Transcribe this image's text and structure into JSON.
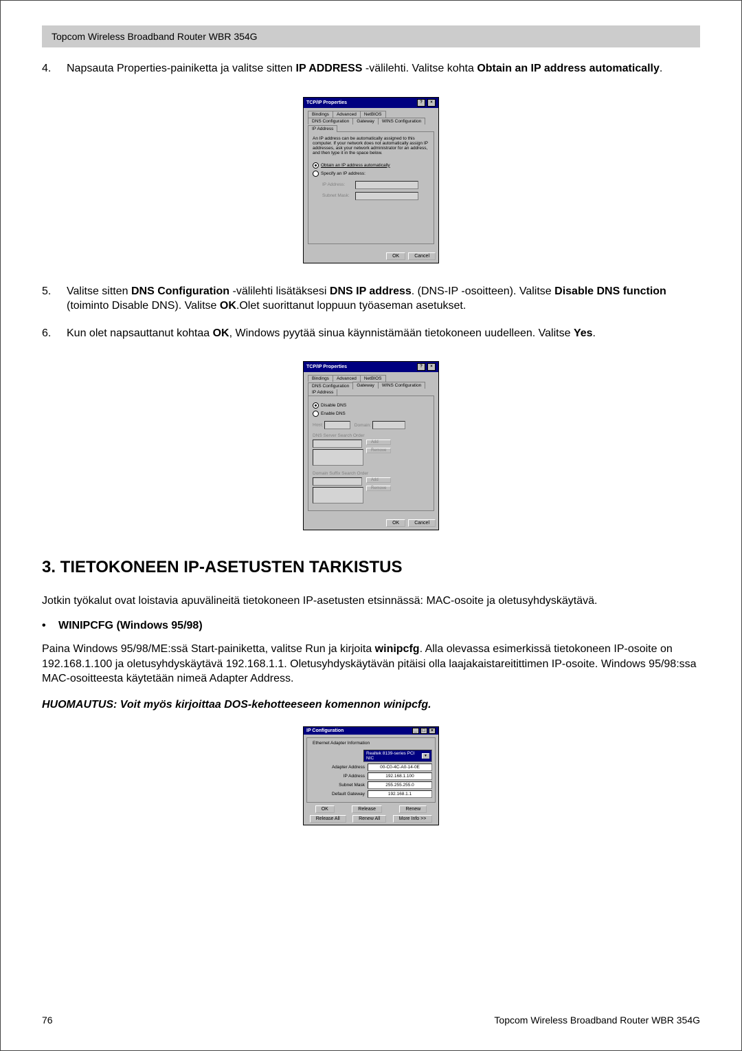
{
  "header_bar": "Topcom Wireless Broadband Router WBR 354G",
  "list": {
    "item4_num": "4.",
    "item4_a": "Napsauta Properties-painiketta ja valitse sitten ",
    "item4_b": "IP ADDRESS",
    "item4_c": " -välilehti. Valitse kohta ",
    "item4_d": "Obtain an IP address automatically",
    "item4_e": ".",
    "item5_num": "5.",
    "item5_a": "Valitse sitten ",
    "item5_b": "DNS Configuration",
    "item5_c": " -välilehti lisätäksesi ",
    "item5_d": "DNS IP address",
    "item5_e": ". (DNS-IP -osoitteen). Valitse ",
    "item5_f": "Disable DNS function",
    "item5_g": " (toiminto Disable DNS). Valitse ",
    "item5_h": "OK",
    "item5_i": ".Olet suorittanut loppuun työaseman asetukset.",
    "item6_num": "6.",
    "item6_a": "Kun olet napsauttanut kohtaa ",
    "item6_b": "OK",
    "item6_c": ", Windows pyytää sinua käynnistämään tietokoneen uudelleen. Valitse ",
    "item6_d": "Yes",
    "item6_e": "."
  },
  "dlg1": {
    "title": "TCP/IP Properties",
    "help": "?",
    "close": "×",
    "tab_bindings": "Bindings",
    "tab_advanced": "Advanced",
    "tab_netbios": "NetBIOS",
    "tab_dns": "DNS Configuration",
    "tab_gateway": "Gateway",
    "tab_wins": "WINS Configuration",
    "tab_ip": "IP Address",
    "desc": "An IP address can be automatically assigned to this computer. If your network does not automatically assign IP addresses, ask your network administrator for an address, and then type it in the space below.",
    "radio_auto": "Obtain an IP address automatically",
    "radio_spec": "Specify an IP address:",
    "lbl_ip": "IP Address:",
    "lbl_mask": "Subnet Mask:",
    "ok": "OK",
    "cancel": "Cancel"
  },
  "dlg2": {
    "title": "TCP/IP Properties",
    "help": "?",
    "close": "×",
    "tab_bindings": "Bindings",
    "tab_advanced": "Advanced",
    "tab_netbios": "NetBIOS",
    "tab_dns": "DNS Configuration",
    "tab_gateway": "Gateway",
    "tab_wins": "WINS Configuration",
    "tab_ip": "IP Address",
    "radio_disable": "Disable DNS",
    "radio_enable": "Enable DNS",
    "lbl_host": "Host:",
    "lbl_domain": "Domain:",
    "lbl_dns_order": "DNS Server Search Order",
    "lbl_suffix": "Domain Suffix Search Order",
    "add": "Add",
    "remove": "Remove",
    "ok": "OK",
    "cancel": "Cancel"
  },
  "section_title": "3. TIETOKONEEN IP-ASETUSTEN TARKISTUS",
  "para1": "Jotkin työkalut ovat loistavia apuvälineitä tietokoneen IP-asetusten etsinnässä: MAC-osoite ja oletusyhdyskäytävä.",
  "bullet1": "WINIPCFG (Windows 95/98)",
  "para2_a": "Paina Windows 95/98/ME:ssä Start-painiketta, valitse Run ja kirjoita ",
  "para2_b": "winipcfg",
  "para2_c": ". Alla olevassa esimerkissä tietokoneen IP-osoite on 192.168.1.100 ja oletusyhdyskäytävä 192.168.1.1. Oletusyhdyskäytävän pitäisi olla laajakaistareitittimen IP-osoite. Windows 95/98:ssa MAC-osoitteesta käytetään nimeä Adapter Address.",
  "note": "HUOMAUTUS: Voit myös kirjoittaa DOS-kehotteeseen komennon winipcfg.",
  "ipcfg": {
    "title": "IP Configuration",
    "min": "_",
    "max": "□",
    "close": "×",
    "group": "Ethernet Adapter Information",
    "adapter": "Realtek 8139-series PCI NIC",
    "lbl_adapter": "Adapter Address",
    "val_adapter": "00-C0-4C-A0-14-0E",
    "lbl_ip": "IP Address",
    "val_ip": "192.168.1.100",
    "lbl_mask": "Subnet Mask",
    "val_mask": "255.255.255.0",
    "lbl_gw": "Default Gateway",
    "val_gw": "192.168.1.1",
    "ok": "OK",
    "release": "Release",
    "renew": "Renew",
    "release_all": "Release All",
    "renew_all": "Renew All",
    "more": "More Info >>"
  },
  "footer": {
    "page": "76",
    "product": "Topcom Wireless Broadband Router WBR 354G"
  }
}
